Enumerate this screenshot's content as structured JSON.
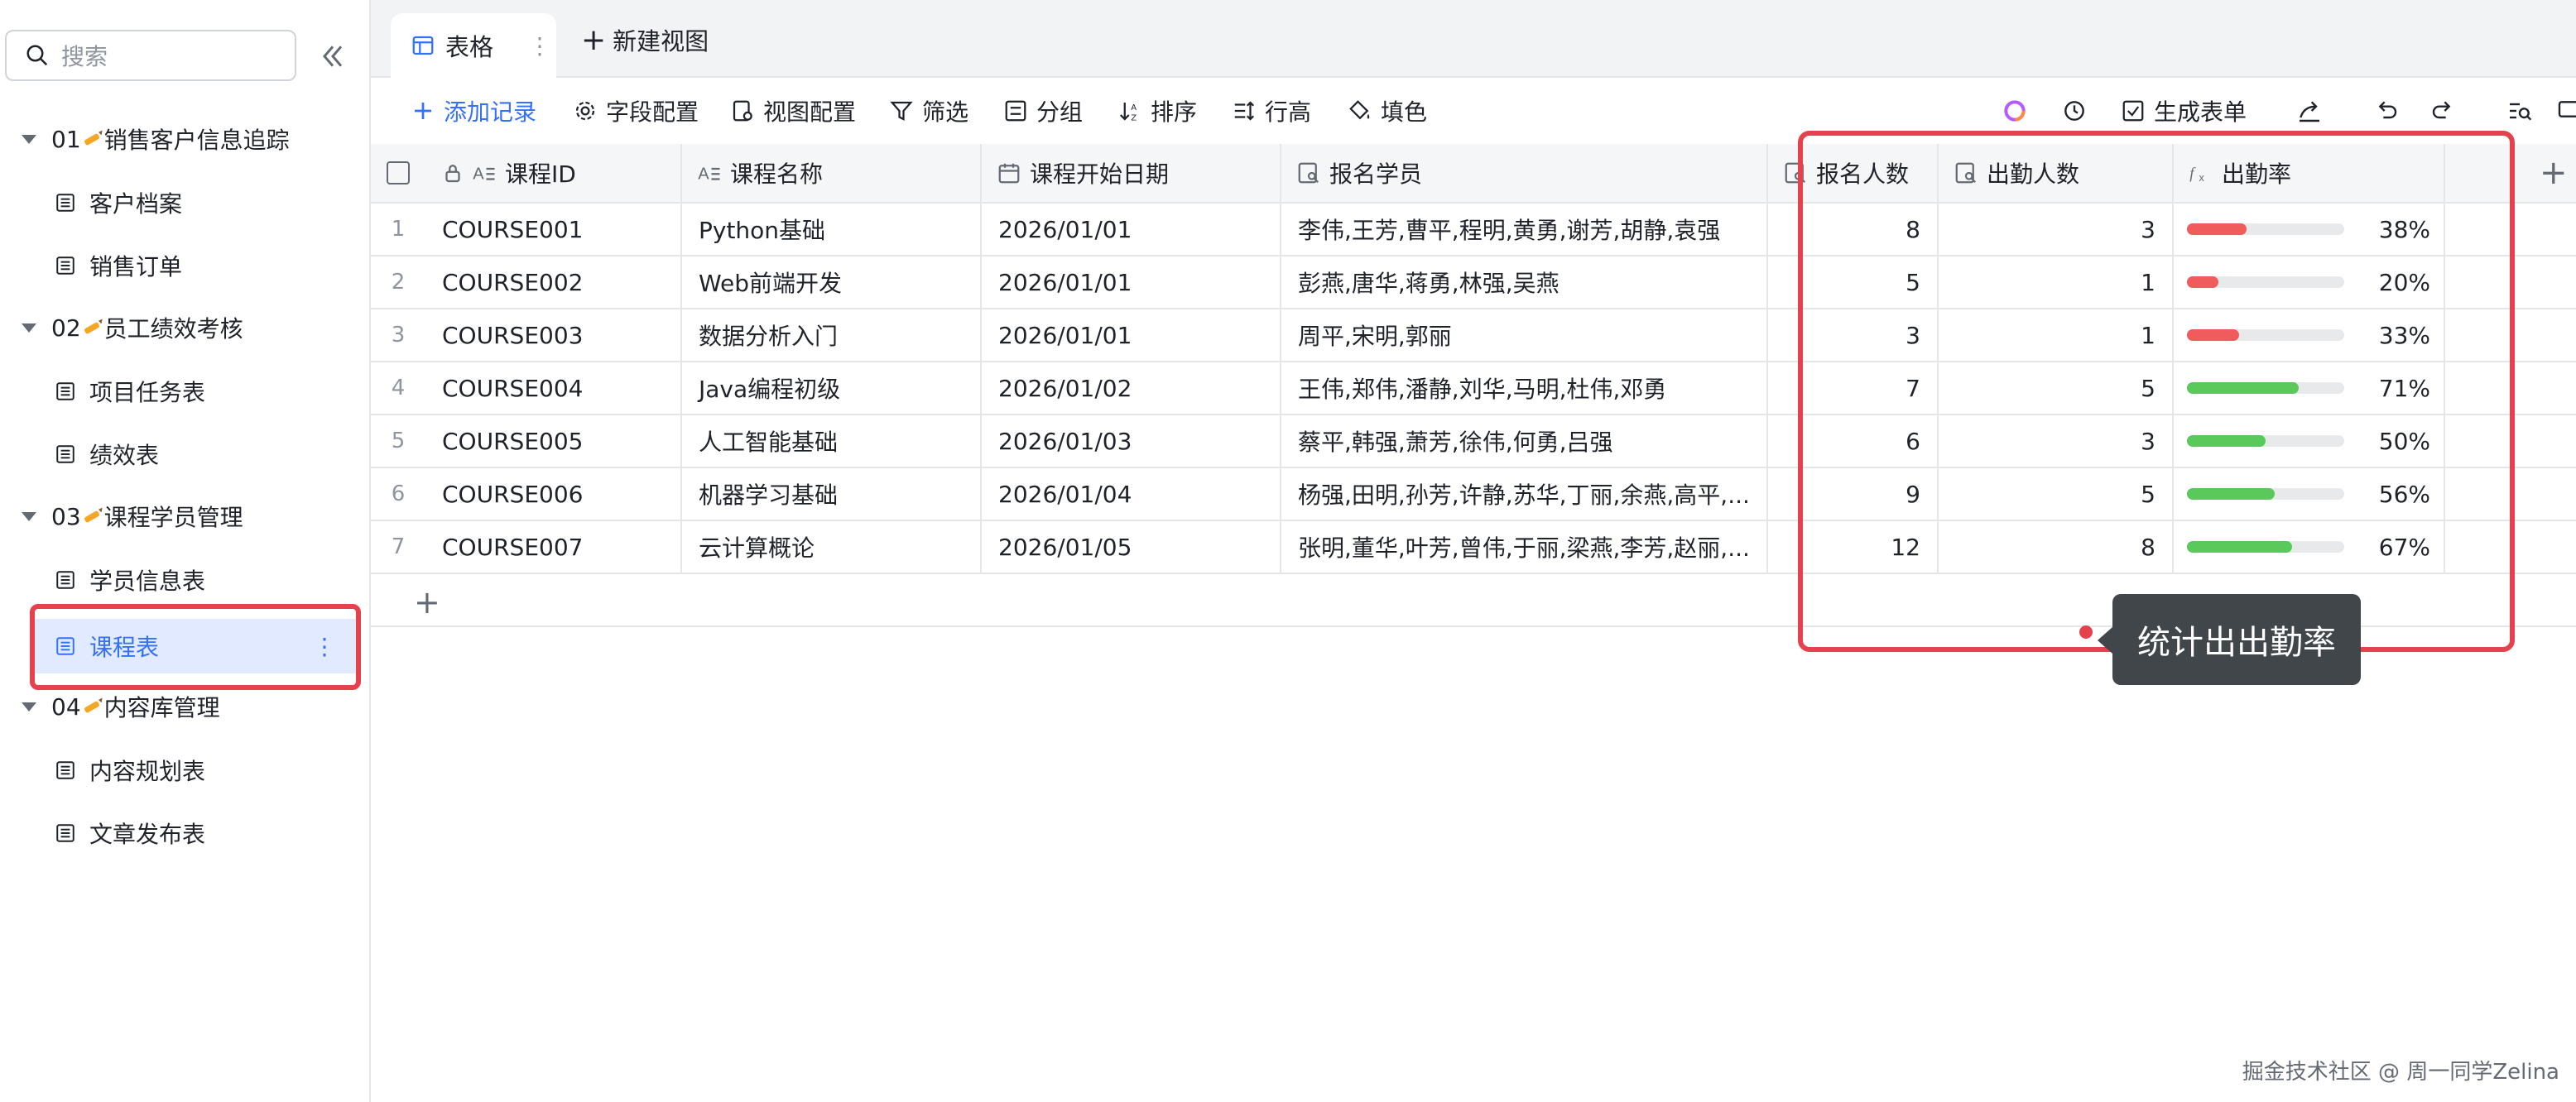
{
  "sidebar": {
    "search_placeholder": "搜索",
    "groups": [
      {
        "label_prefix": "01",
        "label_suffix": "销售客户信息追踪",
        "items": [
          "客户档案",
          "销售订单"
        ]
      },
      {
        "label_prefix": "02",
        "label_suffix": "员工绩效考核",
        "items": [
          "项目任务表",
          "绩效表"
        ]
      },
      {
        "label_prefix": "03",
        "label_suffix": "课程学员管理",
        "items": [
          "学员信息表",
          "课程表"
        ]
      },
      {
        "label_prefix": "04",
        "label_suffix": "内容库管理",
        "items": [
          "内容规划表",
          "文章发布表"
        ]
      }
    ],
    "active_item": "课程表"
  },
  "tabs": {
    "active_label": "表格",
    "new_view_label": "新建视图"
  },
  "toolbar": {
    "add_record": "添加记录",
    "field_config": "字段配置",
    "view_config": "视图配置",
    "filter": "筛选",
    "group": "分组",
    "sort": "排序",
    "row_height": "行高",
    "fill_color": "填色",
    "generate_form": "生成表单"
  },
  "table": {
    "columns": [
      "课程ID",
      "课程名称",
      "课程开始日期",
      "报名学员",
      "报名人数",
      "出勤人数",
      "出勤率"
    ],
    "rows": [
      {
        "idx": "1",
        "id": "COURSE001",
        "name": "Python基础",
        "date": "2026/01/01",
        "students": "李伟,王芳,曹平,程明,黄勇,谢芳,胡静,袁强",
        "enrolled": "8",
        "attended": "3",
        "rate": 0.38,
        "rate_label": "38%"
      },
      {
        "idx": "2",
        "id": "COURSE002",
        "name": "Web前端开发",
        "date": "2026/01/01",
        "students": "彭燕,唐华,蒋勇,林强,吴燕",
        "enrolled": "5",
        "attended": "1",
        "rate": 0.2,
        "rate_label": "20%"
      },
      {
        "idx": "3",
        "id": "COURSE003",
        "name": "数据分析入门",
        "date": "2026/01/01",
        "students": "周平,宋明,郭丽",
        "enrolled": "3",
        "attended": "1",
        "rate": 0.33,
        "rate_label": "33%"
      },
      {
        "idx": "4",
        "id": "COURSE004",
        "name": "Java编程初级",
        "date": "2026/01/02",
        "students": "王伟,郑伟,潘静,刘华,马明,杜伟,邓勇",
        "enrolled": "7",
        "attended": "5",
        "rate": 0.71,
        "rate_label": "71%"
      },
      {
        "idx": "5",
        "id": "COURSE005",
        "name": "人工智能基础",
        "date": "2026/01/03",
        "students": "蔡平,韩强,萧芳,徐伟,何勇,吕强",
        "enrolled": "6",
        "attended": "3",
        "rate": 0.5,
        "rate_label": "50%"
      },
      {
        "idx": "6",
        "id": "COURSE006",
        "name": "机器学习基础",
        "date": "2026/01/04",
        "students": "杨强,田明,孙芳,许静,苏华,丁丽,余燕,高平,...",
        "enrolled": "9",
        "attended": "5",
        "rate": 0.56,
        "rate_label": "56%"
      },
      {
        "idx": "7",
        "id": "COURSE007",
        "name": "云计算概论",
        "date": "2026/01/05",
        "students": "张明,董华,叶芳,曾伟,于丽,梁燕,李芳,赵丽,...",
        "enrolled": "12",
        "attended": "8",
        "rate": 0.67,
        "rate_label": "67%"
      }
    ]
  },
  "annotation": {
    "tooltip": "统计出出勤率"
  },
  "footer": "掘金技术社区 @ 周一同学Zelina",
  "colors": {
    "bar_low": "#f05b5b",
    "bar_high": "#5bc85b",
    "accent": "#3370ff",
    "highlight": "#e5424d"
  }
}
